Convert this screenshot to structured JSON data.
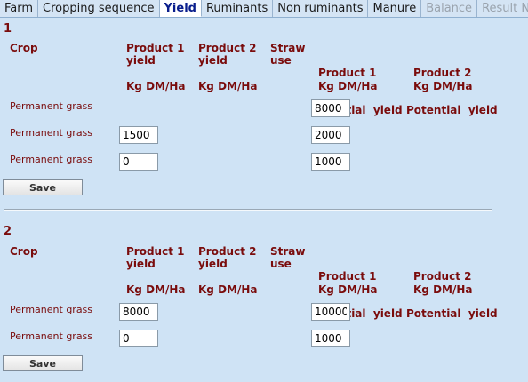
{
  "tabs": [
    {
      "label": "Farm",
      "state": "normal"
    },
    {
      "label": "Cropping sequence",
      "state": "normal"
    },
    {
      "label": "Yield",
      "state": "active"
    },
    {
      "label": "Ruminants",
      "state": "normal"
    },
    {
      "label": "Non ruminants",
      "state": "normal"
    },
    {
      "label": "Manure",
      "state": "normal"
    },
    {
      "label": "Balance",
      "state": "disabled"
    },
    {
      "label": "Result N",
      "state": "disabled"
    }
  ],
  "headers": {
    "crop": "Crop",
    "p1_line1": "Product 1",
    "p1_line2": "yield",
    "p2_line1": "Product 2",
    "p2_line2": "yield",
    "straw_line1": "Straw",
    "straw_line2": "use",
    "p1pot_line1": "Product 1",
    "p1pot_line2": "Potential  yield",
    "p2pot_line1": "Product 2",
    "p2pot_line2": "Potential  yield",
    "unit": "Kg DM/Ha"
  },
  "sections": [
    {
      "title": "1",
      "save_label": "Save",
      "rows": [
        {
          "crop": "Permanent grass",
          "product1_yield": null,
          "product1_potential": "8000"
        },
        {
          "crop": "Permanent grass",
          "product1_yield": "1500",
          "product1_potential": "2000"
        },
        {
          "crop": "Permanent grass",
          "product1_yield": "0",
          "product1_potential": "1000"
        }
      ]
    },
    {
      "title": "2",
      "save_label": "Save",
      "rows": [
        {
          "crop": "Permanent grass",
          "product1_yield": "8000",
          "product1_potential": "10000"
        },
        {
          "crop": "Permanent grass",
          "product1_yield": "0",
          "product1_potential": "1000"
        }
      ]
    }
  ]
}
